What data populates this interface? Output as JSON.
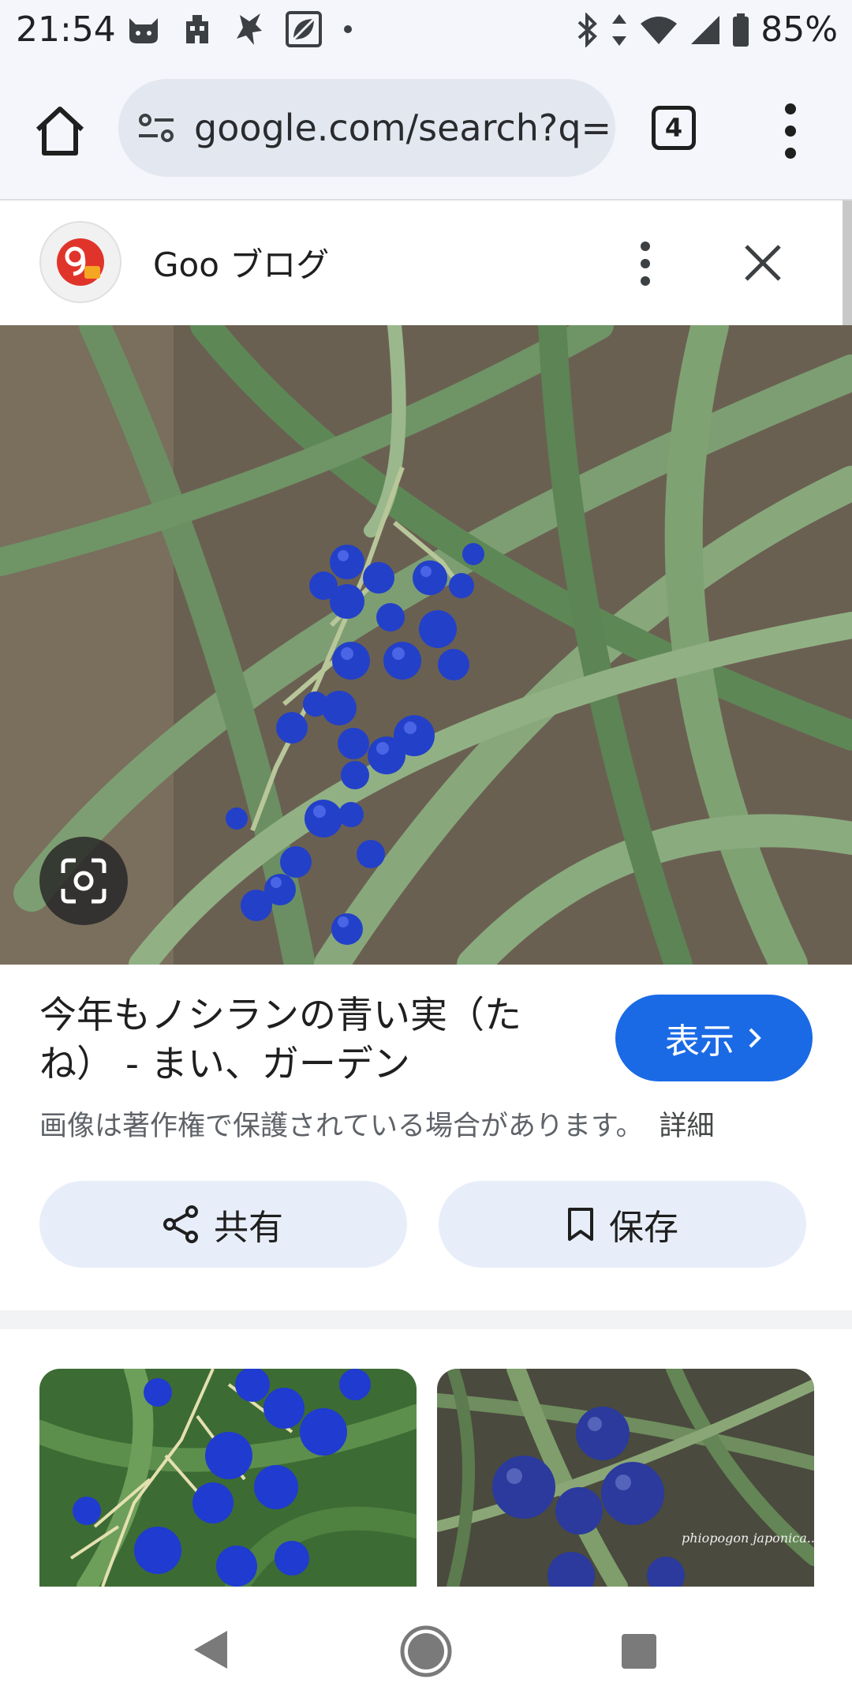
{
  "status_bar": {
    "time": "21:54",
    "battery": "85%",
    "icons_left": [
      "cat-icon",
      "building-icon",
      "character-icon",
      "leaf-square-icon",
      "dot-icon"
    ],
    "icons_right": [
      "bluetooth-icon",
      "data-arrows-icon",
      "wifi-icon",
      "signal-icon",
      "battery-icon"
    ]
  },
  "browser": {
    "url": "google.com/search?q=",
    "tab_count": "4"
  },
  "source": {
    "name": "Goo ブログ"
  },
  "result": {
    "title": "今年もノシランの青い実（たね） - まい、ガーデン",
    "view_label": "表示",
    "copyright_notice": "画像は著作権で保護されている場合があります。",
    "details_label": "詳細",
    "share_label": "共有",
    "save_label": "保存"
  },
  "thumbnails": [
    {
      "watermark": ""
    },
    {
      "watermark": "phiopogon japonica..."
    }
  ],
  "colors": {
    "accent": "#1a6ae6",
    "chrome_bg": "#f4f6fb",
    "pill_bg": "#e8eef9",
    "berry": "#2340c8",
    "leaf": "#5f8a5a"
  }
}
